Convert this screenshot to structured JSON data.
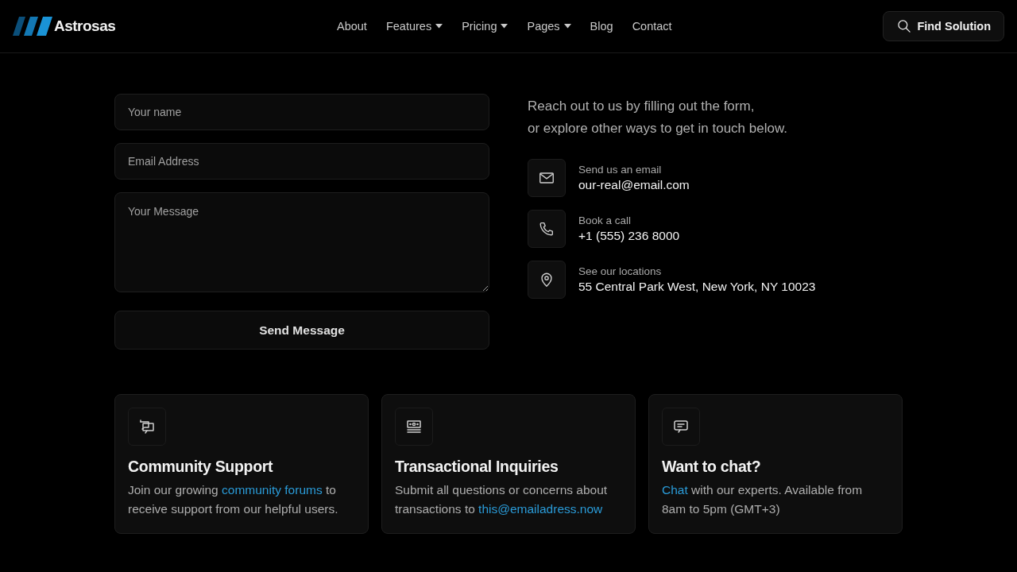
{
  "header": {
    "logo_text": "Astrosas",
    "nav": [
      {
        "label": "About",
        "dropdown": false
      },
      {
        "label": "Features",
        "dropdown": true
      },
      {
        "label": "Pricing",
        "dropdown": true
      },
      {
        "label": "Pages",
        "dropdown": true
      },
      {
        "label": "Blog",
        "dropdown": false
      },
      {
        "label": "Contact",
        "dropdown": false
      }
    ],
    "search_button": "Find Solution"
  },
  "form": {
    "fields": [
      {
        "kind": "input",
        "placeholder": "Your name"
      },
      {
        "kind": "input",
        "placeholder": "Email Address"
      },
      {
        "kind": "textarea",
        "placeholder": "Your Message"
      }
    ],
    "submit": "Send Message"
  },
  "intro_lines": [
    "Reach out to us by filling out the form,",
    "or explore other ways to get in touch below."
  ],
  "contacts": [
    {
      "kind": "email",
      "label": "Send us an email",
      "value": "our-real@email.com"
    },
    {
      "kind": "phone",
      "label": "Book a call",
      "value": "+1 (555) 236 8000"
    },
    {
      "kind": "location",
      "label": "See our locations",
      "value": "55 Central Park West, New York, NY 10023"
    }
  ],
  "cards": [
    {
      "kind": "community",
      "title": "Community Support",
      "body": [
        {
          "text": "Join our growing ",
          "link": false
        },
        {
          "text": "community forums",
          "link": true
        },
        {
          "text": " to receive support from our helpful users.",
          "link": false
        }
      ]
    },
    {
      "kind": "transactions",
      "title": "Transactional Inquiries",
      "body": [
        {
          "text": "Submit all questions or concerns about transactions to ",
          "link": false
        },
        {
          "text": "this@emailadress.now",
          "link": true
        }
      ]
    },
    {
      "kind": "chat",
      "title": "Want to chat?",
      "body": [
        {
          "text": "Chat",
          "link": true
        },
        {
          "text": " with our experts. Available from 8am to 5pm (GMT+3)",
          "link": false
        }
      ]
    }
  ]
}
